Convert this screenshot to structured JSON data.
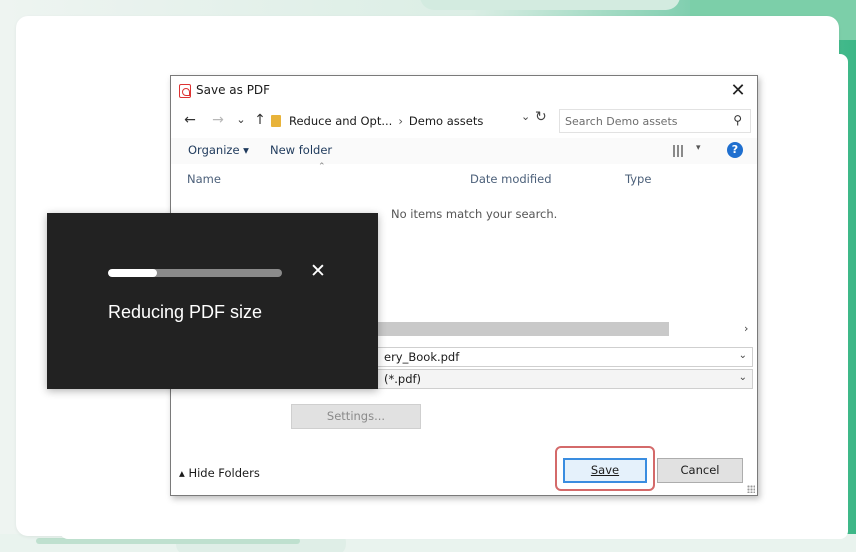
{
  "dialog": {
    "title": "Save as PDF",
    "close": "✕",
    "nav": {
      "back": "←",
      "forward": "→",
      "recent": "⌄",
      "up": "↑"
    },
    "breadcrumb": [
      "Reduce and Opt...",
      "Demo assets"
    ],
    "breadcrumb_sep": "›",
    "address_dropdown": "⌄",
    "refresh": "↻",
    "search_placeholder": "Search Demo assets",
    "toolbar": {
      "organize": "Organize ▾",
      "new_folder": "New folder",
      "view_dropdown": "▾",
      "help": "?"
    },
    "columns": {
      "name": "Name",
      "date": "Date modified",
      "type": "Type"
    },
    "empty_message": "No items match your search.",
    "file_name": "ery_Book.pdf",
    "file_type": "(*.pdf)",
    "settings": "Settings...",
    "hide_folders": "Hide Folders",
    "save": "Save",
    "cancel": "Cancel"
  },
  "progress": {
    "label": "Reducing PDF size",
    "fraction": 0.28,
    "close": "✕"
  },
  "colors": {
    "accent": "#1f6fcf",
    "highlight": "#d46a6a",
    "panel": "#222222",
    "brand_green": "#3cb787"
  }
}
